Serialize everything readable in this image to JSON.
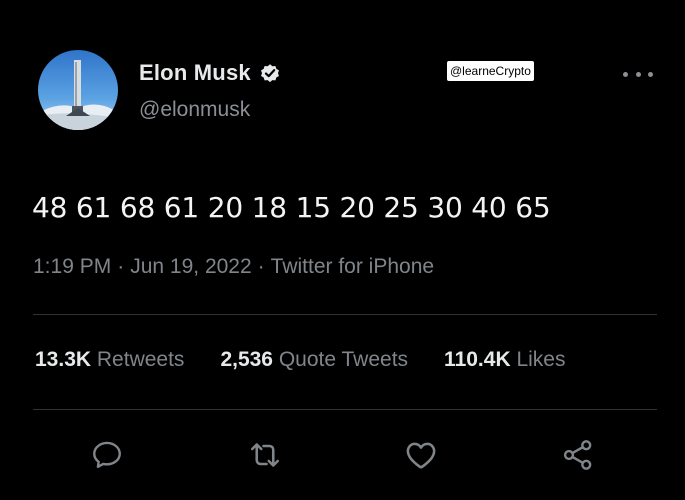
{
  "author": {
    "display_name": "Elon Musk",
    "handle": "@elonmusk",
    "verified": true,
    "avatar": "rocket-launch-photo"
  },
  "watermark": "@learneCrypto",
  "tweet": {
    "text": "48 61 68 61 20 18 15 20 25 30 40 65",
    "time": "1:19 PM",
    "date": "Jun 19, 2022",
    "separator": "·",
    "source": "Twitter for iPhone"
  },
  "stats": [
    {
      "value": "13.3K",
      "label": "Retweets"
    },
    {
      "value": "2,536",
      "label": "Quote Tweets"
    },
    {
      "value": "110.4K",
      "label": "Likes"
    }
  ],
  "actions": [
    {
      "name": "reply",
      "icon": "speech-bubble-icon"
    },
    {
      "name": "retweet",
      "icon": "retweet-arrows-icon"
    },
    {
      "name": "like",
      "icon": "heart-icon"
    },
    {
      "name": "share",
      "icon": "share-nodes-icon"
    }
  ],
  "colors": {
    "background": "#000000",
    "primary_text": "#e7e9ea",
    "secondary_text": "#80858a",
    "divider": "#2f3336",
    "verified_badge": "#e7e9ea"
  }
}
